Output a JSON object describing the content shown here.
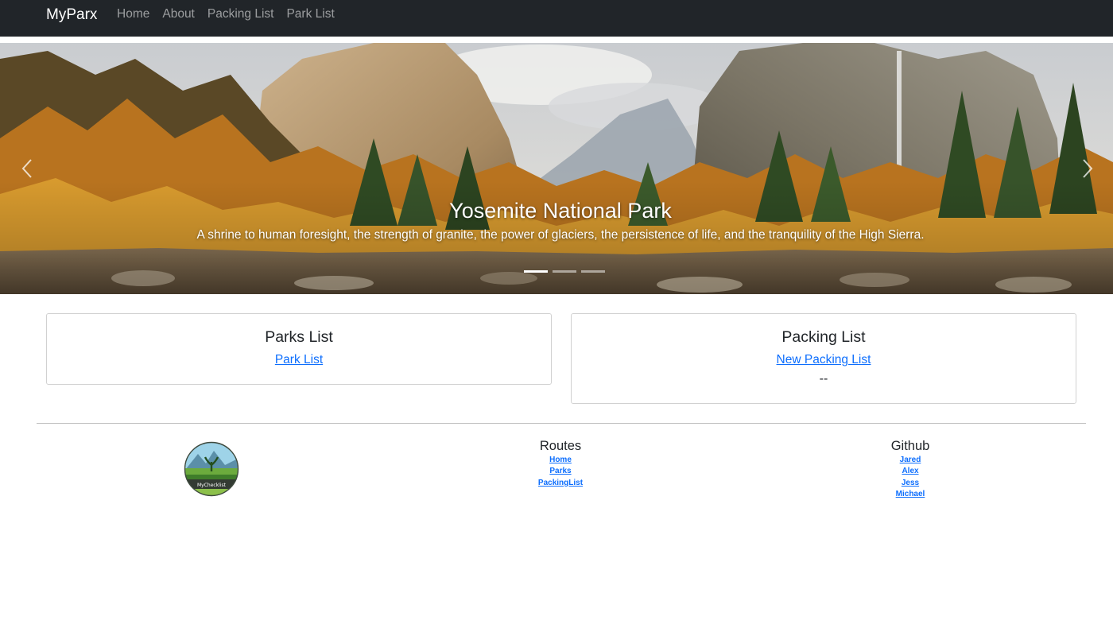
{
  "navbar": {
    "brand": "MyParx",
    "links": [
      "Home",
      "About",
      "Packing List",
      "Park List"
    ]
  },
  "carousel": {
    "title": "Yosemite National Park",
    "caption": "A shrine to human foresight, the strength of granite, the power of glaciers, the persistence of life, and the tranquility of the High Sierra.",
    "slide_count": 3,
    "active_slide": 1
  },
  "cards": {
    "parks": {
      "title": "Parks List",
      "link": "Park List"
    },
    "packing": {
      "title": "Packing List",
      "link": "New Packing List",
      "extra": "--"
    }
  },
  "footer": {
    "logo_text": "MyChecklist",
    "routes": {
      "heading": "Routes",
      "links": [
        "Home",
        "Parks",
        "PackingList"
      ]
    },
    "github": {
      "heading": "Github",
      "links": [
        "Jared",
        "Alex",
        "Jess",
        "Michael"
      ]
    }
  },
  "colors": {
    "navbar_bg": "#212529",
    "link": "#0d6efd"
  }
}
